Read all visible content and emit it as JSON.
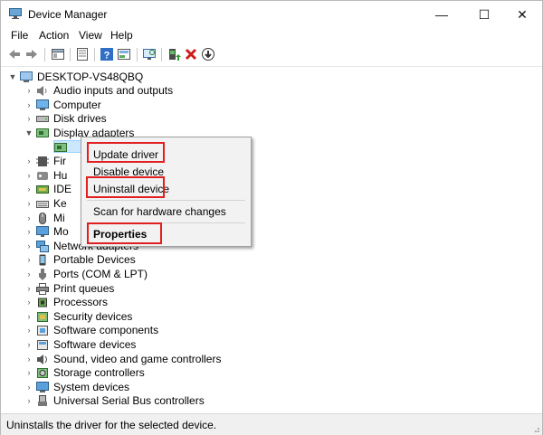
{
  "window": {
    "title": "Device Manager",
    "minimize_glyph": "—",
    "maximize_glyph": "☐",
    "close_glyph": "✕"
  },
  "menu": [
    "File",
    "Action",
    "View",
    "Help"
  ],
  "toolbar": {
    "icons": [
      "back-arrow-icon",
      "forward-arrow-icon",
      "properties-pane-icon",
      "device-list-icon",
      "help-icon",
      "show-hidden-icon",
      "monitor-scan-icon",
      "update-driver-icon",
      "uninstall-x-icon",
      "download-driver-icon"
    ]
  },
  "tree": {
    "root": "DESKTOP-VS48QBQ",
    "items": [
      {
        "label": "Audio inputs and outputs",
        "icon": "speaker-icon"
      },
      {
        "label": "Computer",
        "icon": "computer-icon"
      },
      {
        "label": "Disk drives",
        "icon": "disk-drive-icon"
      },
      {
        "label": "Display adapters",
        "icon": "display-adapter-icon",
        "expanded": true
      },
      {
        "label": "Firmware",
        "icon": "firmware-icon"
      },
      {
        "label": "Human Interface Devices",
        "icon": "hid-icon"
      },
      {
        "label": "IDE ATA/ATAPI controllers",
        "icon": "ide-icon"
      },
      {
        "label": "Keyboards",
        "icon": "keyboard-icon"
      },
      {
        "label": "Mice and other pointing devices",
        "icon": "mouse-icon"
      },
      {
        "label": "Monitors",
        "icon": "monitor-icon"
      },
      {
        "label": "Network adapters",
        "icon": "network-icon"
      },
      {
        "label": "Portable Devices",
        "icon": "portable-device-icon"
      },
      {
        "label": "Ports (COM & LPT)",
        "icon": "port-icon"
      },
      {
        "label": "Print queues",
        "icon": "printer-icon"
      },
      {
        "label": "Processors",
        "icon": "processor-icon"
      },
      {
        "label": "Security devices",
        "icon": "security-device-icon"
      },
      {
        "label": "Software components",
        "icon": "software-component-icon"
      },
      {
        "label": "Software devices",
        "icon": "software-device-icon"
      },
      {
        "label": "Sound, video and game controllers",
        "icon": "sound-icon"
      },
      {
        "label": "Storage controllers",
        "icon": "storage-icon"
      },
      {
        "label": "System devices",
        "icon": "system-device-icon"
      },
      {
        "label": "Universal Serial Bus controllers",
        "icon": "usb-icon"
      }
    ],
    "visible_labels": {
      "firmware": "Fir",
      "hid": "Hu",
      "ide": "IDE",
      "keyboards": "Ke",
      "mice": "Mi",
      "monitors": "Mo"
    }
  },
  "context_menu": {
    "update_driver": "Update driver",
    "disable_device": "Disable device",
    "uninstall_device": "Uninstall device",
    "scan": "Scan for hardware changes",
    "properties": "Properties",
    "highlight_color": "#e02020"
  },
  "status": "Uninstalls the driver for the selected device."
}
